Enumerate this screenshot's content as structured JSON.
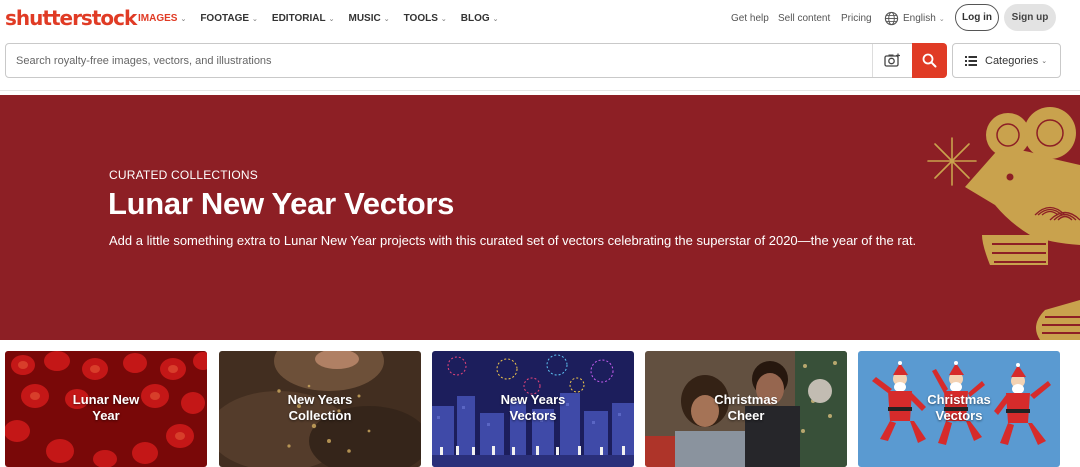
{
  "brand": {
    "logo_text": "shutterstock",
    "accent": "#e03b25"
  },
  "nav": {
    "items": [
      {
        "label": "IMAGES",
        "active": true
      },
      {
        "label": "FOOTAGE"
      },
      {
        "label": "EDITORIAL"
      },
      {
        "label": "MUSIC"
      },
      {
        "label": "TOOLS"
      },
      {
        "label": "BLOG"
      }
    ],
    "chevron": "⌄",
    "get_help": "Get help",
    "sell_content": "Sell content",
    "pricing": "Pricing",
    "language": "English",
    "login": "Log in",
    "signup": "Sign up"
  },
  "search": {
    "placeholder": "Search royalty-free images, vectors, and illustrations",
    "value": "",
    "camera_icon": "camera-icon",
    "search_icon": "search-icon",
    "categories_label": "Categories"
  },
  "hero": {
    "eyebrow": "CURATED COLLECTIONS",
    "title": "Lunar New Year Vectors",
    "description": "Add a little something extra to Lunar New Year projects with this curated set of vectors celebrating the superstar of 2020—the year of the rat.",
    "background": "#8d1f25",
    "art_color": "#c9a24d"
  },
  "tiles": [
    {
      "label": "Lunar New\nYear"
    },
    {
      "label": "New Years\nCollection"
    },
    {
      "label": "New Years\nVectors"
    },
    {
      "label": "Christmas\nCheer"
    },
    {
      "label": "Christmas\nVectors"
    }
  ]
}
